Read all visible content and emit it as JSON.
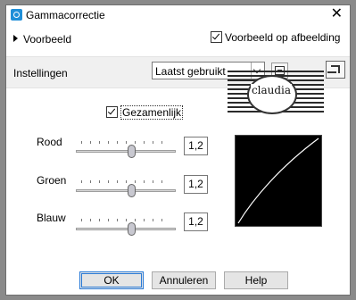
{
  "window": {
    "title": "Gammacorrectie",
    "close_glyph": "✕"
  },
  "preview": {
    "toggle_label": "Voorbeeld",
    "image_preview_label": "Voorbeeld op afbeelding",
    "image_preview_checked": true
  },
  "settings": {
    "label": "Instellingen",
    "preset_value": "Laatst gebruikt"
  },
  "watermark": {
    "text": "claudia"
  },
  "gamma": {
    "linked_label": "Gezamenlijk",
    "linked_checked": true,
    "channels": [
      {
        "label": "Rood",
        "value": "1,2",
        "slider_fraction": 0.55
      },
      {
        "label": "Groen",
        "value": "1,2",
        "slider_fraction": 0.55
      },
      {
        "label": "Blauw",
        "value": "1,2",
        "slider_fraction": 0.55
      }
    ]
  },
  "buttons": {
    "ok": "OK",
    "cancel": "Annuleren",
    "help": "Help"
  },
  "colors": {
    "accent": "#2a7ad6",
    "curve_background": "#000000",
    "curve_line": "#ffffff"
  },
  "icons": {
    "app": "gamma-app-icon",
    "close": "close-icon",
    "expand": "triangle-right-icon",
    "save": "floppy-disk-icon",
    "reset": "reset-icon"
  }
}
